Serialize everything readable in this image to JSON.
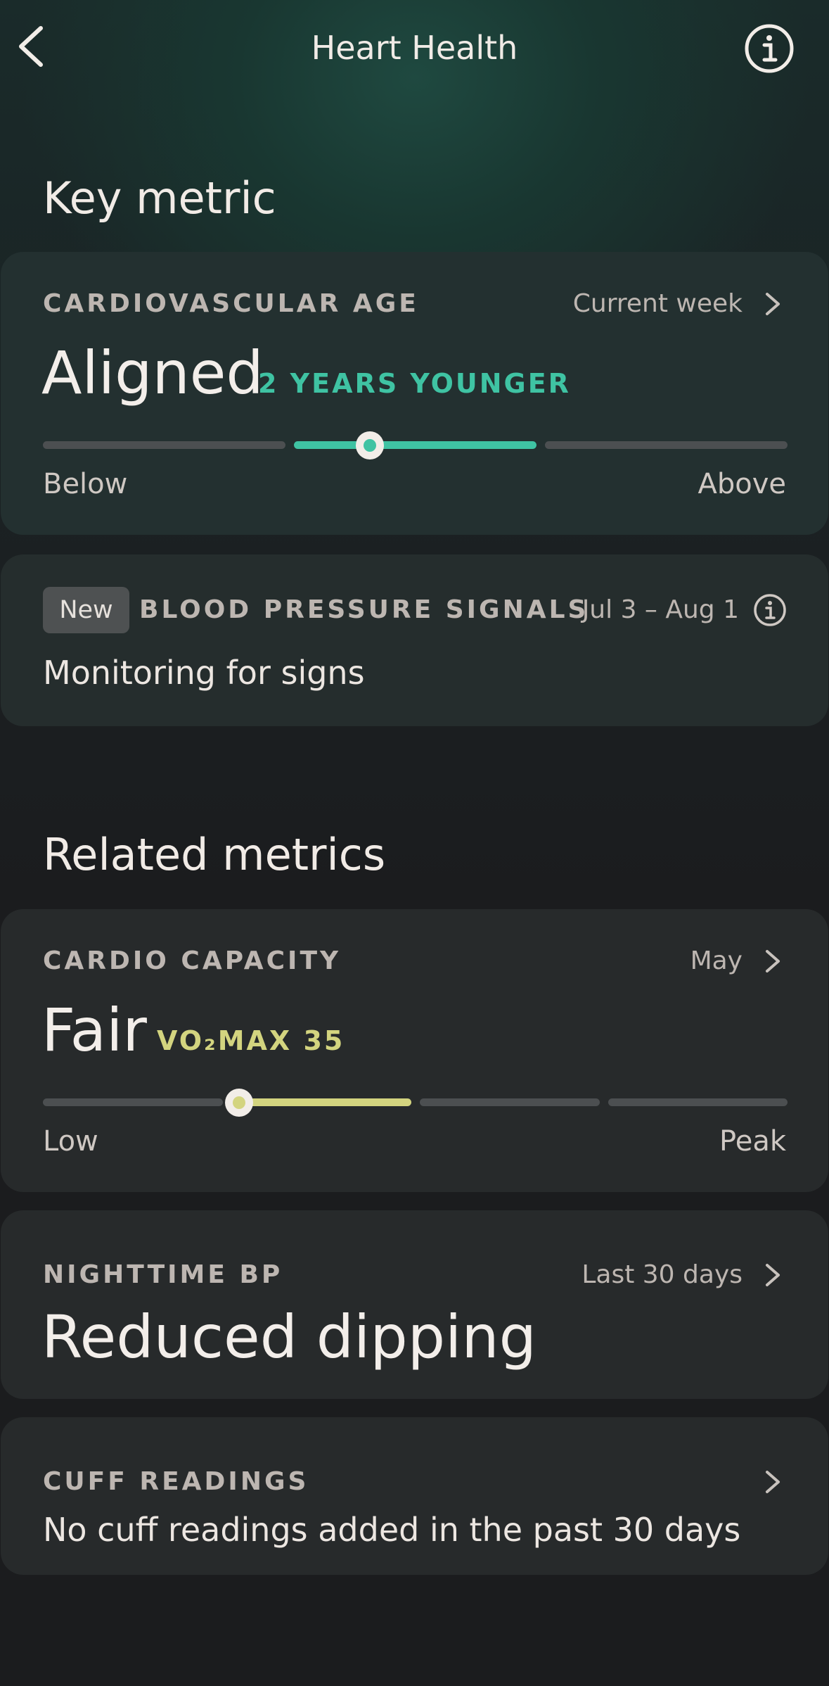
{
  "header": {
    "title": "Heart Health",
    "back_icon": "chevron-left-icon",
    "info_icon": "info-circle-icon"
  },
  "key_metric": {
    "section_title": "Key metric",
    "cardiovascular_age": {
      "label": "CARDIOVASCULAR AGE",
      "period": "Current week",
      "value": "Aligned",
      "detail": "2 YEARS YOUNGER",
      "detail_color": "#3fc3a3",
      "scale_min_label": "Below",
      "scale_max_label": "Above",
      "active_segment": 2,
      "segment_count": 3,
      "marker_position_in_segment": 0.3
    },
    "blood_pressure": {
      "badge": "New",
      "label": "BLOOD PRESSURE SIGNALS",
      "date_range": "Jul 3 – Aug 1",
      "status": "Monitoring for signs"
    }
  },
  "related_metrics": {
    "section_title": "Related metrics",
    "cardio_capacity": {
      "label": "CARDIO CAPACITY",
      "period": "May",
      "value": "Fair",
      "detail": "VO₂MAX 35",
      "detail_color": "#d3d47f",
      "scale_min_label": "Low",
      "scale_max_label": "Peak",
      "active_segment": 2,
      "segment_count": 4,
      "marker_position_in_segment": 0.0
    },
    "nighttime_bp": {
      "label": "NIGHTTIME BP",
      "period": "Last 30 days",
      "value": "Reduced dipping"
    },
    "cuff_readings": {
      "label": "CUFF READINGS",
      "status": "No cuff readings added in the past 30 days"
    }
  },
  "colors": {
    "accent_teal": "#3fc3a3",
    "accent_yellow": "#d3d47f",
    "track": "#4c4f51"
  }
}
